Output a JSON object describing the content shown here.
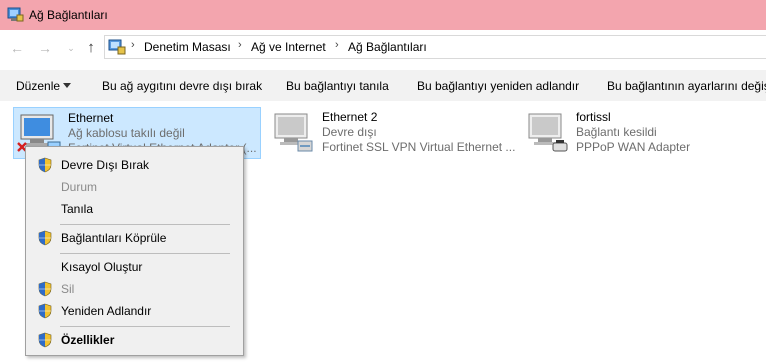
{
  "window": {
    "title": "Ağ Bağlantıları"
  },
  "nav": {
    "back_icon": "arrow-left-icon",
    "forward_icon": "arrow-right-icon",
    "recent_icon": "chevron-down-icon",
    "up_icon": "arrow-up-icon",
    "breadcrumb": [
      "Denetim Masası",
      "Ağ ve Internet",
      "Ağ Bağlantıları"
    ]
  },
  "commands": {
    "organize": "Düzenle",
    "disable": "Bu ağ aygıtını devre dışı bırak",
    "diagnose": "Bu bağlantıyı tanıla",
    "rename": "Bu bağlantıyı yeniden adlandır",
    "settings": "Bu bağlantının ayarlarını değiş"
  },
  "connections": [
    {
      "name": "Ethernet",
      "status": "Ağ kablosu takılı değil",
      "adapter": "Fortinet Virtual Ethernet Adapter (...",
      "icon": "network-adapter-icon",
      "badge": "red-x-icon"
    },
    {
      "name": "Ethernet 2",
      "status": "Devre dışı",
      "adapter": "Fortinet SSL VPN Virtual Ethernet ...",
      "icon": "network-adapter-icon"
    },
    {
      "name": "fortissl",
      "status": "Bağlantı kesildi",
      "adapter": "PPPoP WAN Adapter",
      "icon": "dialup-connection-icon"
    }
  ],
  "context_menu": {
    "disable": "Devre Dışı Bırak",
    "status": "Durum",
    "diagnose": "Tanıla",
    "bridge": "Bağlantıları Köprüle",
    "shortcut": "Kısayol Oluştur",
    "delete": "Sil",
    "rename": "Yeniden Adlandır",
    "properties": "Özellikler"
  },
  "colors": {
    "titlebar": "#f3a5ae",
    "selection": "#cce8ff",
    "commandbar": "#f2f2f2"
  }
}
